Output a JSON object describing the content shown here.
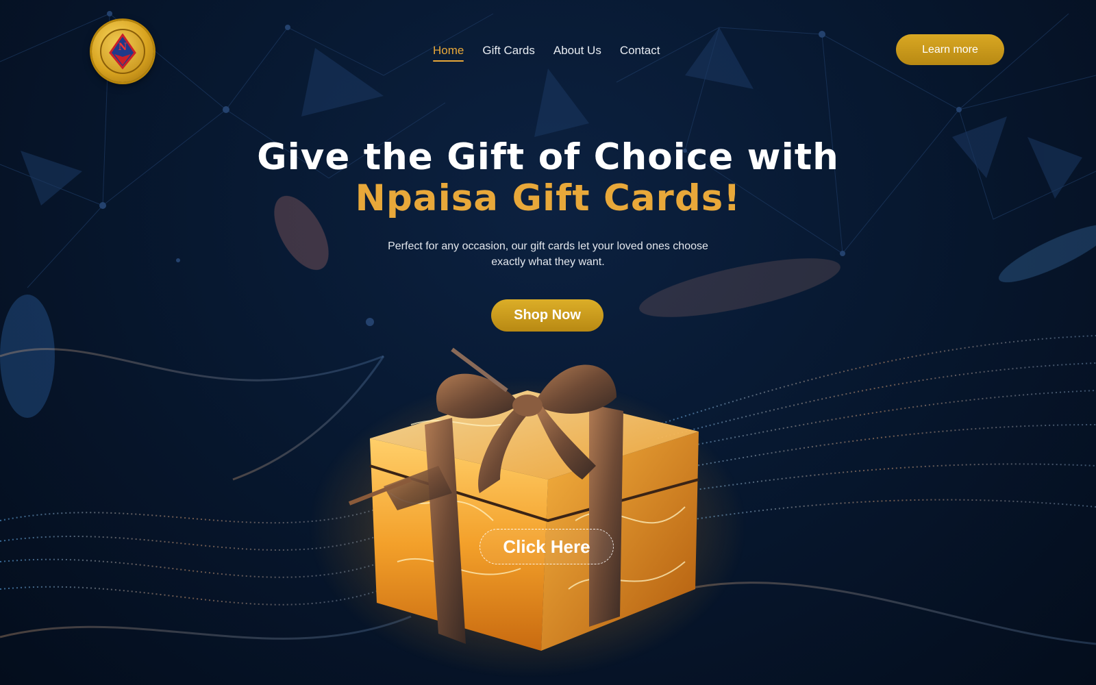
{
  "header": {
    "logo_letter": "N",
    "nav": [
      {
        "label": "Home",
        "active": true
      },
      {
        "label": "Gift Cards",
        "active": false
      },
      {
        "label": "About Us",
        "active": false
      },
      {
        "label": "Contact",
        "active": false
      }
    ],
    "cta_label": "Learn more"
  },
  "hero": {
    "title_line1": "Give the Gift of Choice with",
    "title_line2": "Npaisa Gift Cards!",
    "subtitle": "Perfect for any occasion, our gift cards let your loved ones choose exactly what they want.",
    "shop_label": "Shop Now",
    "click_label": "Click Here"
  },
  "colors": {
    "accent_gold": "#e8a83a",
    "button_gold": "#c9991b",
    "background": "#061426"
  }
}
